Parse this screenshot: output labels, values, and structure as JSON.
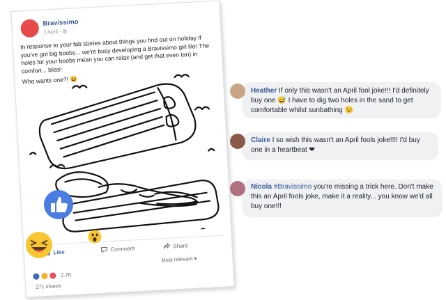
{
  "post": {
    "page_name": "Bravissimo",
    "meta": "1 April · ",
    "paragraph1": "In response to your fab stories about things you find out on holiday if you've got big boobs... we're busy developing a Bravissimo girl lilo! The holes for your boobs mean you can relax (and get that even tan) in comfort... bliss!",
    "paragraph2": "Who wants one?! 😆",
    "like_label": "Like",
    "comment_label": "Comment",
    "share_label": "Share",
    "sort_label": "Most relevant ▾",
    "reaction_count": "2.7K",
    "shares_count": "271 shares",
    "brand_color": "#e84a4a",
    "link_color": "#385898"
  },
  "comments": [
    {
      "name": "Heather",
      "text": " If only this wasn't an April fool joke!!! I'd definitely buy one 😅 I have to dig two holes in the sand to get comfortable whilst sunbathing 😉",
      "avatar_color": "#c9a586"
    },
    {
      "name": "Claire",
      "text": " I so wish this wasn't an April fools joke!!!! I'd buy one in a heartbeat ❤",
      "avatar_color": "#8a5a4a"
    },
    {
      "name": "Nicola",
      "tag": "#Bravissimo",
      "text": " you're missing a trick here. Don't make this an April fools joke, make it a reality... you know we'd all buy one!!!",
      "avatar_color": "#b07080"
    }
  ],
  "floating": {
    "like_bubble": "thumbs-up-icon",
    "laugh_emoji": "laughing-emoji-icon",
    "wow_emoji": "surprised-emoji-icon"
  }
}
